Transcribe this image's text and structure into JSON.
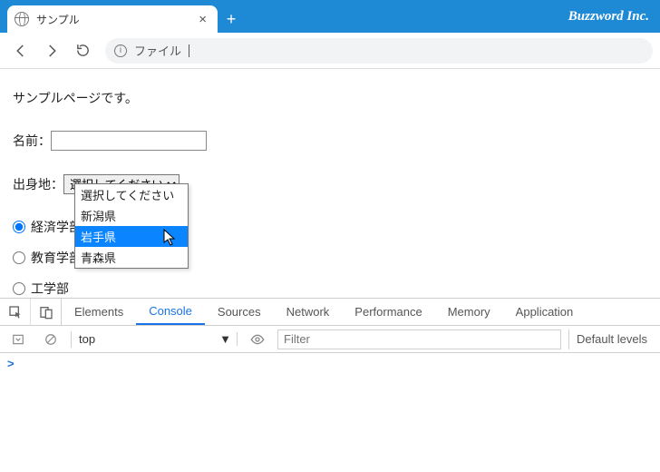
{
  "window": {
    "tab_title": "サンプル",
    "brand": "Buzzword Inc."
  },
  "addressbar": {
    "label": "ファイル"
  },
  "page": {
    "heading": "サンプルページです。",
    "name_label": "名前：",
    "name_value": "",
    "origin_label": "出身地：",
    "select_placeholder": "選択してください",
    "dropdown_options": [
      "選択してください",
      "新潟県",
      "岩手県",
      "青森県"
    ],
    "dropdown_highlight_index": 2,
    "radios": [
      {
        "label": "経済学部",
        "checked": true
      },
      {
        "label": "教育学部",
        "checked": false
      },
      {
        "label": "工学部",
        "checked": false
      }
    ]
  },
  "devtools": {
    "tabs": [
      "Elements",
      "Console",
      "Sources",
      "Network",
      "Performance",
      "Memory",
      "Application"
    ],
    "active_tab_index": 1,
    "context": "top",
    "filter_placeholder": "Filter",
    "levels_label": "Default levels",
    "prompt": ">"
  }
}
